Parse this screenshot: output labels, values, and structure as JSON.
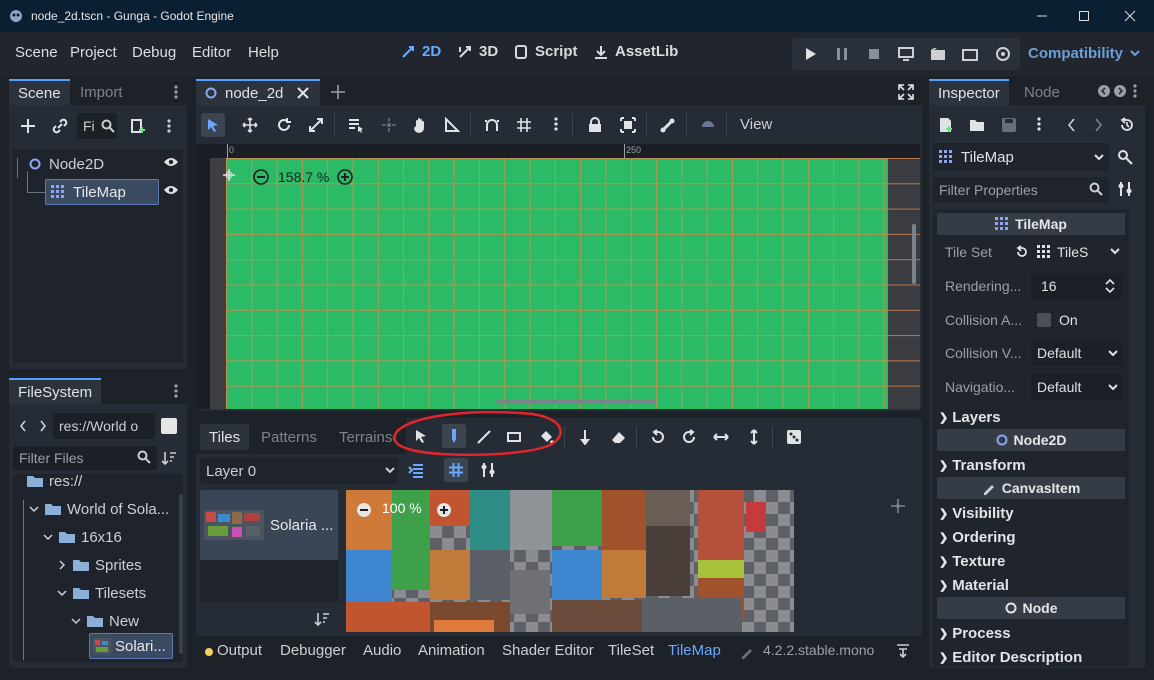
{
  "window": {
    "title": "node_2d.tscn - Gunga - Godot Engine"
  },
  "menu": {
    "scene": "Scene",
    "project": "Project",
    "debug": "Debug",
    "editor": "Editor",
    "help": "Help"
  },
  "modes": {
    "m2d": "2D",
    "m3d": "3D",
    "script": "Script",
    "assetlib": "AssetLib"
  },
  "renderer": "Compatibility",
  "scene_dock": {
    "tab_scene": "Scene",
    "tab_import": "Import",
    "filter": "Fi",
    "tree": [
      {
        "label": "Node2D"
      },
      {
        "label": "TileMap"
      }
    ]
  },
  "filesystem": {
    "tab": "FileSystem",
    "path": "res://World o",
    "filter_placeholder": "Filter Files",
    "items": [
      {
        "label": "res://"
      },
      {
        "label": "World of Sola..."
      },
      {
        "label": "16x16"
      },
      {
        "label": "Sprites"
      },
      {
        "label": "Tilesets"
      },
      {
        "label": "New"
      },
      {
        "label": "Solari..."
      }
    ]
  },
  "viewport": {
    "tab": "node_2d",
    "view_menu": "View",
    "zoom": "158.7 %",
    "ruler_ticks": [
      "0",
      "250"
    ],
    "canvas_color": "#2bbb66",
    "grid_color": "#e08a4a"
  },
  "tiles_panel": {
    "tab_tiles": "Tiles",
    "tab_patterns": "Patterns",
    "tab_terrains": "Terrains",
    "layer": "Layer 0",
    "source": "Solaria ...",
    "atlas_zoom": "100 %"
  },
  "inspector": {
    "tab_inspector": "Inspector",
    "tab_node": "Node",
    "object": "TileMap",
    "filter_placeholder": "Filter Properties",
    "section_tilemap": "TileMap",
    "props": [
      {
        "label": "Tile Set",
        "value": "TileS"
      },
      {
        "label": "Rendering...",
        "value": "16"
      },
      {
        "label": "Collision A...",
        "value": "On"
      },
      {
        "label": "Collision V...",
        "value": "Default"
      },
      {
        "label": "Navigatio...",
        "value": "Default"
      }
    ],
    "group_layers": "Layers",
    "section_node2d": "Node2D",
    "group_transform": "Transform",
    "section_canvasitem": "CanvasItem",
    "groups_canvas": [
      "Visibility",
      "Ordering",
      "Texture",
      "Material"
    ],
    "section_node": "Node",
    "groups_node": [
      "Process",
      "Editor Description"
    ]
  },
  "bottom_tabs": {
    "output": "Output",
    "debugger": "Debugger",
    "audio": "Audio",
    "animation": "Animation",
    "shader_editor": "Shader Editor",
    "tileset": "TileSet",
    "tilemap": "TileMap",
    "version": "4.2.2.stable.mono"
  },
  "colors": {
    "accent": "#55a0ff",
    "annotation": "#e0262b",
    "background": "#1d2229"
  }
}
